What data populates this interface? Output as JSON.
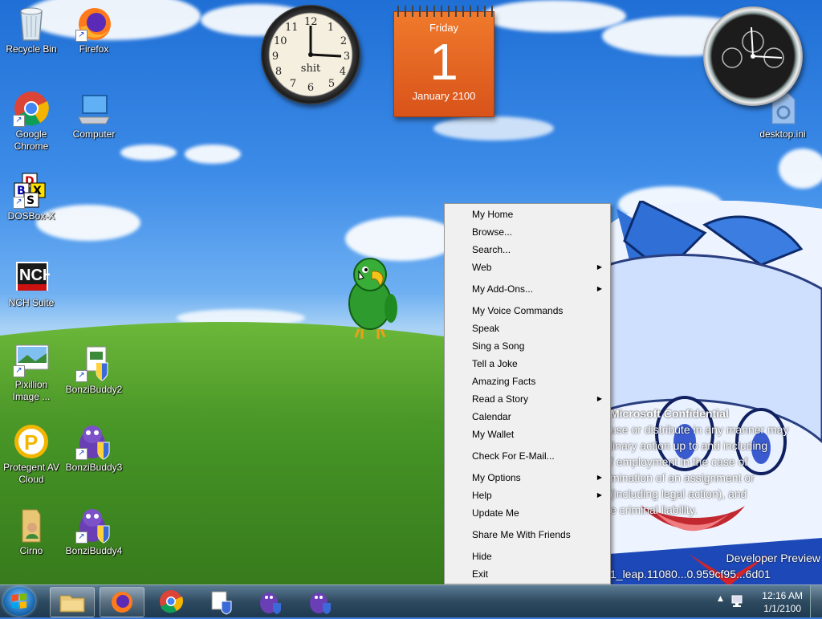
{
  "desktop": {
    "icons": [
      {
        "label": "Recycle Bin"
      },
      {
        "label": "Firefox"
      },
      {
        "label": "Google Chrome"
      },
      {
        "label": "Computer"
      },
      {
        "label": "DOSBox-X"
      },
      {
        "label": "NCH Suite"
      },
      {
        "label": "Pixillion Image ..."
      },
      {
        "label": "BonziBuddy2"
      },
      {
        "label": "Protegent AV Cloud"
      },
      {
        "label": "BonziBuddy3"
      },
      {
        "label": "Cirno"
      },
      {
        "label": "BonziBuddy4"
      },
      {
        "label": "desktop.ini"
      }
    ]
  },
  "gadgets": {
    "clock": {
      "brand": "shit",
      "numbers": [
        "12",
        "1",
        "2",
        "3",
        "4",
        "5",
        "6",
        "7",
        "8",
        "9",
        "10",
        "11"
      ]
    },
    "calendar": {
      "day": "Friday",
      "date": "1",
      "month": "January 2100"
    }
  },
  "wallpaper_text": {
    "line1": "Microsoft Confidential",
    "line2": "use or distribute in any manner may",
    "line3": "linary action up to and including",
    "line4": "f employment in the case of",
    "line5": "mination of an assignment or",
    "line6": "(including legal action), and",
    "line7": "e criminal liability.",
    "line8": "Developer Preview",
    "line9": "1_leap.11080...0.959cf95...6d01"
  },
  "context_menu": {
    "items": [
      {
        "label": "My Home",
        "submenu": false
      },
      {
        "label": "Browse...",
        "submenu": false
      },
      {
        "label": "Search...",
        "submenu": false
      },
      {
        "label": "Web",
        "submenu": true
      },
      {
        "label": "My Add-Ons...",
        "submenu": true
      },
      {
        "label": "My Voice Commands",
        "submenu": false
      },
      {
        "label": "Speak",
        "submenu": false
      },
      {
        "label": "Sing a Song",
        "submenu": false
      },
      {
        "label": "Tell a Joke",
        "submenu": false
      },
      {
        "label": "Amazing Facts",
        "submenu": false
      },
      {
        "label": "Read a Story",
        "submenu": true
      },
      {
        "label": "Calendar",
        "submenu": false
      },
      {
        "label": "My Wallet",
        "submenu": false
      },
      {
        "label": "Check For E-Mail...",
        "submenu": false
      },
      {
        "label": "My Options",
        "submenu": true
      },
      {
        "label": "Help",
        "submenu": true
      },
      {
        "label": "Update Me",
        "submenu": false
      },
      {
        "label": "Share Me With Friends",
        "submenu": false
      },
      {
        "label": "Hide",
        "submenu": false
      },
      {
        "label": "Exit",
        "submenu": false
      }
    ],
    "arrow_glyph": "▶"
  },
  "taskbar": {
    "pinned": [
      {
        "icon": "file-explorer-icon",
        "active": true
      },
      {
        "icon": "firefox-icon",
        "active": true
      },
      {
        "icon": "chrome-icon",
        "active": false
      },
      {
        "icon": "installer-icon",
        "active": false
      },
      {
        "icon": "bonzibuddy-icon",
        "active": false
      },
      {
        "icon": "bonzibuddy-icon",
        "active": false
      }
    ],
    "clock": {
      "time": "12:16 AM",
      "date": "1/1/2100"
    },
    "tray_chevron": "▲"
  },
  "colors": {
    "taskbar": "#2e4a60",
    "calendar": "#e8641f",
    "menu_bg": "#f0f0f0",
    "parrot": "#2e9b2e"
  }
}
